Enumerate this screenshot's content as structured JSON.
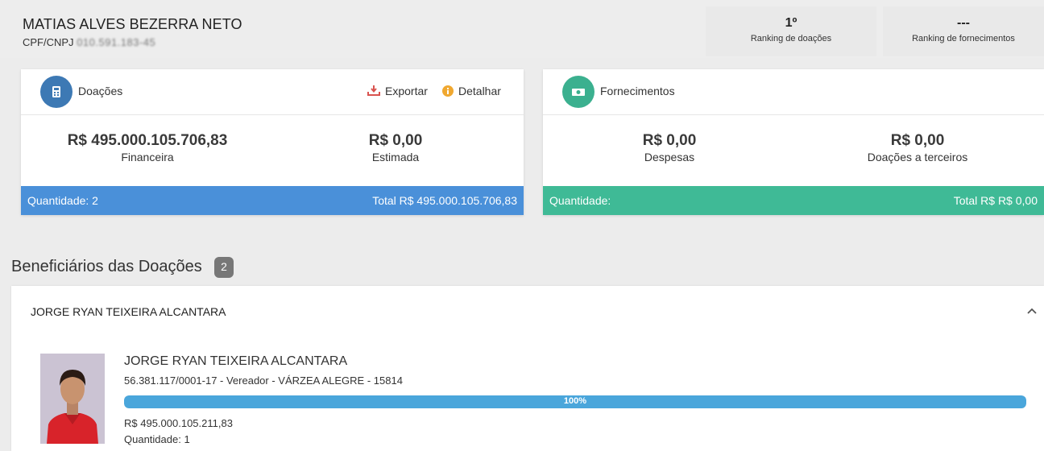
{
  "donor": {
    "name": "MATIAS ALVES BEZERRA NETO",
    "doc_label": "CPF/CNPJ",
    "doc_value": "010.591.183-45"
  },
  "rankings": [
    {
      "value": "1º",
      "label": "Ranking de doações"
    },
    {
      "value": "---",
      "label": "Ranking de fornecimentos"
    }
  ],
  "donations_card": {
    "title": "Doações",
    "icon": "calculator-icon",
    "export_label": "Exportar",
    "detail_label": "Detalhar",
    "stats": [
      {
        "amount": "R$ 495.000.105.706,83",
        "caption": "Financeira"
      },
      {
        "amount": "R$ 0,00",
        "caption": "Estimada"
      }
    ],
    "footer_left": "Quantidade: 2",
    "footer_right": "Total R$ 495.000.105.706,83",
    "color": "#4a90d9"
  },
  "supplies_card": {
    "title": "Fornecimentos",
    "icon": "money-icon",
    "stats": [
      {
        "amount": "R$ 0,00",
        "caption": "Despesas"
      },
      {
        "amount": "R$ 0,00",
        "caption": "Doações a terceiros"
      }
    ],
    "footer_left": "Quantidade:",
    "footer_right": "Total R$ R$ 0,00",
    "color": "#3fba96"
  },
  "beneficiaries": {
    "title": "Beneficiários das Doações",
    "count": "2",
    "items": [
      {
        "header": "JORGE RYAN TEIXEIRA ALCANTARA",
        "name": "JORGE RYAN TEIXEIRA ALCANTARA",
        "info": "56.381.117/0001-17 - Vereador - VÁRZEA ALEGRE - 15814",
        "percent": 100,
        "percent_label": "100%",
        "amount": "R$ 495.000.105.211,83",
        "quantity": "Quantidade: 1"
      }
    ]
  }
}
